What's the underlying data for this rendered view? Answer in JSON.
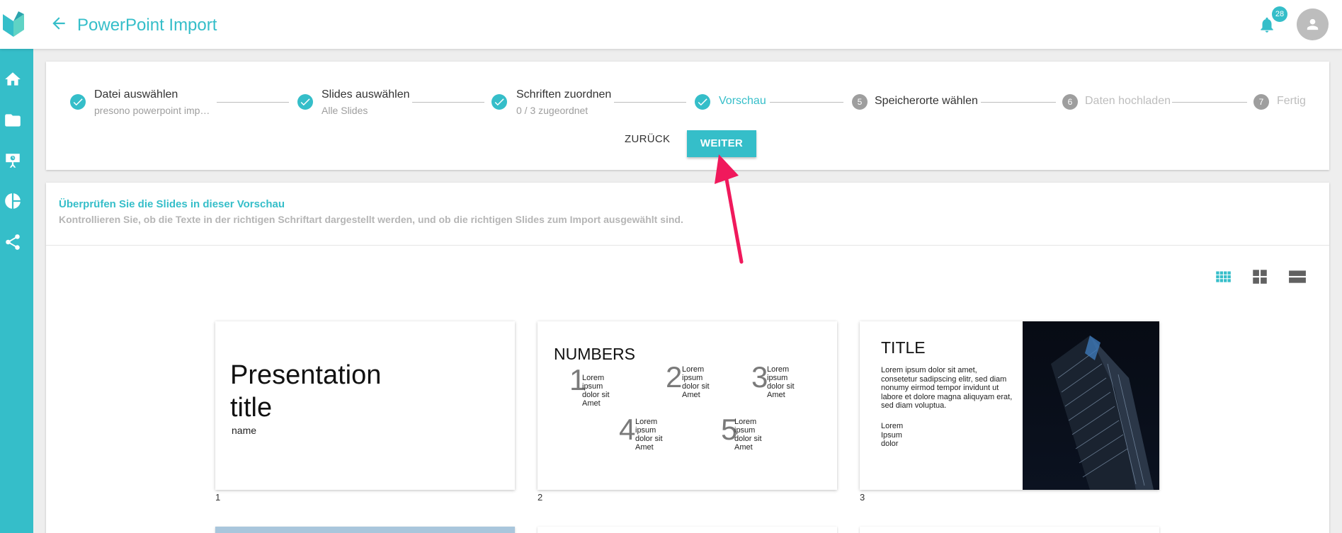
{
  "app": {
    "title": "PowerPoint Import",
    "notification_count": "28"
  },
  "colors": {
    "accent": "#35bec9",
    "annotation_arrow": "#f0195c"
  },
  "sidebar": {
    "items": [
      {
        "icon": "home-icon"
      },
      {
        "icon": "folder-icon"
      },
      {
        "icon": "presentation-icon"
      },
      {
        "icon": "pie-chart-icon"
      },
      {
        "icon": "share-icon"
      }
    ]
  },
  "stepper": {
    "steps": [
      {
        "label": "Datei auswählen",
        "sub": "presono powerpoint imp…",
        "state": "done"
      },
      {
        "label": "Slides auswählen",
        "sub": "Alle Slides",
        "state": "done"
      },
      {
        "label": "Schriften zuordnen",
        "sub": "0 / 3 zugeordnet",
        "state": "done"
      },
      {
        "label": "Vorschau",
        "state": "active"
      },
      {
        "number": "5",
        "label": "Speicherorte wählen",
        "state": "todo"
      },
      {
        "number": "6",
        "label": "Daten hochladen",
        "state": "disabled"
      },
      {
        "number": "7",
        "label": "Fertig",
        "state": "disabled"
      }
    ],
    "back_label": "ZURÜCK",
    "next_label": "WEITER"
  },
  "preview": {
    "title": "Überprüfen Sie die Slides in dieser Vorschau",
    "subtitle": "Kontrollieren Sie, ob die Texte in der richtigen Schriftart dargestellt werden, und ob die richtigen Slides zum Import ausgewählt sind.",
    "view_modes": [
      "grid-small-icon",
      "grid-large-icon",
      "list-icon"
    ]
  },
  "slides": [
    {
      "number": "1",
      "title_line1": "Presentation",
      "title_line2": "title",
      "name": "name"
    },
    {
      "number": "2",
      "title": "NUMBERS",
      "items": [
        {
          "n": "1",
          "text": "Lorem ipsum dolor sit Amet"
        },
        {
          "n": "2",
          "text": "Lorem ipsum dolor sit Amet"
        },
        {
          "n": "3",
          "text": "Lorem ipsum dolor sit Amet"
        },
        {
          "n": "4",
          "text": "Lorem ipsum dolor sit Amet"
        },
        {
          "n": "5",
          "text": "Lorem ipsum dolor sit Amet"
        }
      ]
    },
    {
      "number": "3",
      "title": "TITLE",
      "body": "Lorem ipsum dolor sit amet, consetetur sadipscing elitr, sed diam nonumy eirmod tempor invidunt ut labore et dolore magna aliquyam erat, sed diam voluptua.",
      "list_1": "Lorem",
      "list_2": "Ipsum",
      "list_3": "dolor"
    }
  ]
}
